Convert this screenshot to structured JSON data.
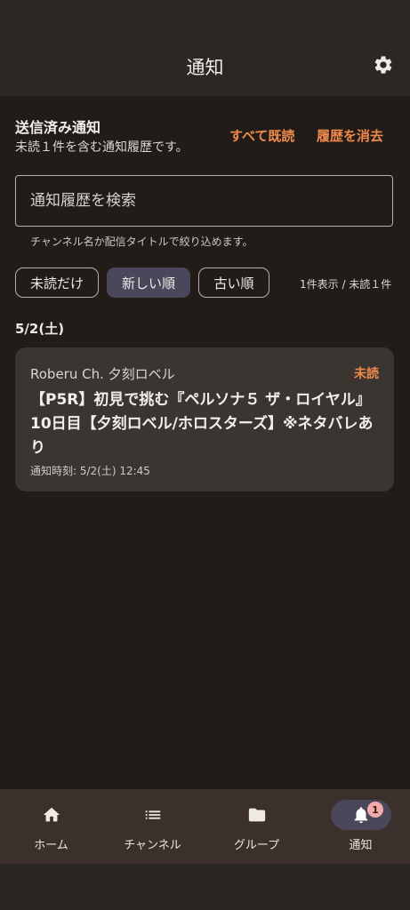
{
  "header": {
    "title": "通知"
  },
  "section": {
    "title": "送信済み通知",
    "subtitle": "未読１件を含む通知履歴です。",
    "mark_all_read": "すべて既読",
    "clear_history": "履歴を消去"
  },
  "search": {
    "placeholder": "通知履歴を検索",
    "value": "",
    "helper": "チャンネル名か配信タイトルで絞り込めます。"
  },
  "filters": {
    "unread_only": "未読だけ",
    "newest": "新しい順",
    "oldest": "古い順",
    "selected": "新しい順"
  },
  "count_text": "1件表示 / 未読１件",
  "groups": [
    {
      "date": "5/2(土)",
      "items": [
        {
          "channel": "Roberu Ch. 夕刻ロベル",
          "status": "未読",
          "title": "【P5R】初見で挑む『ペルソナ５ ザ・ロイヤル』10日目【夕刻ロベル/ホロスターズ】※ネタバレあり",
          "time": "通知時刻: 5/2(土) 12:45"
        }
      ]
    }
  ],
  "nav": [
    {
      "label": "ホーム",
      "icon": "home-icon"
    },
    {
      "label": "チャンネル",
      "icon": "list-icon"
    },
    {
      "label": "グループ",
      "icon": "folder-icon"
    },
    {
      "label": "通知",
      "icon": "bell-icon",
      "badge": "1",
      "active": true
    }
  ],
  "colors": {
    "background": "#221c19",
    "header": "#2b2724",
    "accent": "#f08a4b",
    "active_chip": "#4a475b",
    "card": "#3a3531",
    "nav": "#3b302b",
    "badge": "#f1a9a9"
  }
}
